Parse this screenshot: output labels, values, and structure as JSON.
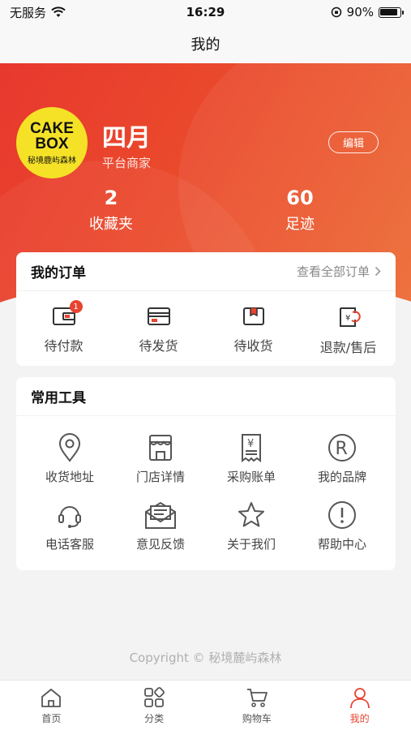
{
  "status_bar": {
    "carrier": "无服务",
    "time": "16:29",
    "battery_percent": "90%",
    "battery_level": 0.9
  },
  "nav": {
    "title": "我的"
  },
  "profile": {
    "avatar_logo_line1": "CAKE",
    "avatar_logo_line2": "BOX",
    "avatar_logo_sub": "秘境鹿屿森林",
    "name": "四月",
    "role": "平台商家",
    "edit_label": "编辑"
  },
  "stats": [
    {
      "value": "2",
      "label": "收藏夹"
    },
    {
      "value": "60",
      "label": "足迹"
    }
  ],
  "orders": {
    "title": "我的订单",
    "view_all": "查看全部订单",
    "items": [
      {
        "label": "待付款",
        "icon": "wallet-icon",
        "badge": "1"
      },
      {
        "label": "待发货",
        "icon": "card-icon"
      },
      {
        "label": "待收货",
        "icon": "package-icon"
      },
      {
        "label": "退款/售后",
        "icon": "refund-icon"
      }
    ]
  },
  "tools": {
    "title": "常用工具",
    "items": [
      {
        "label": "收货地址",
        "icon": "location-icon"
      },
      {
        "label": "门店详情",
        "icon": "store-icon"
      },
      {
        "label": "采购账单",
        "icon": "bill-icon"
      },
      {
        "label": "我的品牌",
        "icon": "registered-icon"
      },
      {
        "label": "电话客服",
        "icon": "headset-icon"
      },
      {
        "label": "意见反馈",
        "icon": "mail-icon"
      },
      {
        "label": "关于我们",
        "icon": "star-icon"
      },
      {
        "label": "帮助中心",
        "icon": "exclamation-icon"
      }
    ]
  },
  "copyright": "Copyright © 秘境麓屿森林",
  "tab_bar": {
    "items": [
      {
        "label": "首页",
        "icon": "home-icon"
      },
      {
        "label": "分类",
        "icon": "category-icon"
      },
      {
        "label": "购物车",
        "icon": "cart-icon"
      },
      {
        "label": "我的",
        "icon": "user-icon"
      }
    ],
    "active_index": 3
  },
  "colors": {
    "accent": "#e8432f",
    "hero_start": "#e8382e",
    "hero_end": "#ec6a33",
    "avatar_bg": "#f5e227"
  }
}
